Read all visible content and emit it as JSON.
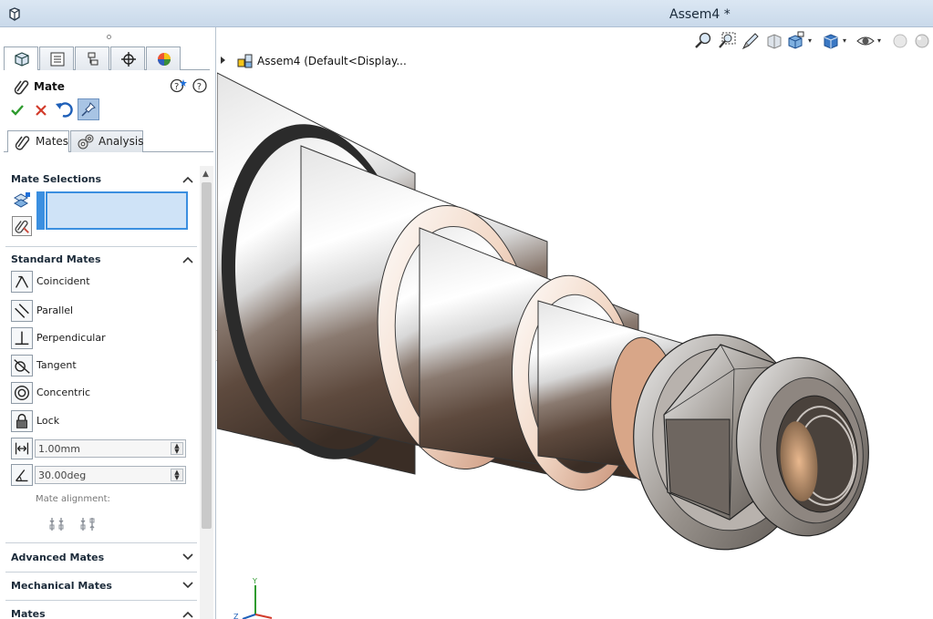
{
  "app": {
    "title": "Assem4 *"
  },
  "property_manager": {
    "title": "Mate",
    "subtabs": [
      "Mates",
      "Analysis"
    ],
    "sections": {
      "mate_selections": "Mate Selections",
      "standard_mates": "Standard Mates",
      "advanced_mates": "Advanced Mates",
      "mechanical_mates": "Mechanical Mates",
      "mates": "Mates"
    },
    "standard_mates": [
      "Coincident",
      "Parallel",
      "Perpendicular",
      "Tangent",
      "Concentric",
      "Lock"
    ],
    "distance_value": "1.00mm",
    "angle_value": "30.00deg",
    "mate_alignment_label": "Mate alignment:"
  },
  "tree": {
    "root_label": "Assem4  (Default<Display..."
  },
  "axis_triad": {
    "y": "Y",
    "z": "Z"
  },
  "colors": {
    "accent": "#3b8fe0",
    "titlebar": "#c9d9ea",
    "selection_fill": "#cfe3f7"
  }
}
